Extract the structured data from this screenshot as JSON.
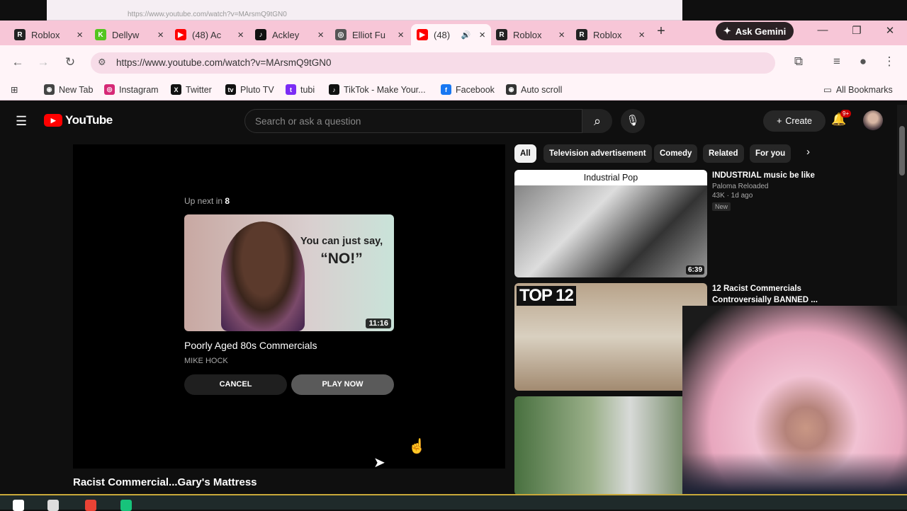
{
  "ghost_url": "https://www.youtube.com/watch?v=MArsmQ9tGN0",
  "tabs": [
    {
      "title": "Roblox",
      "fav": "R",
      "color": "#222"
    },
    {
      "title": "Dellyw",
      "fav": "K",
      "color": "#53c51f"
    },
    {
      "title": "(48) Ac",
      "fav": "▶",
      "color": "#ff0000"
    },
    {
      "title": "Ackley",
      "fav": "♪",
      "color": "#111"
    },
    {
      "title": "Elliot Fu",
      "fav": "◎",
      "color": "#555"
    },
    {
      "title": "(48)",
      "fav": "▶",
      "color": "#ff0000"
    },
    {
      "title": "Roblox",
      "fav": "R",
      "color": "#222"
    },
    {
      "title": "Roblox",
      "fav": "R",
      "color": "#222"
    }
  ],
  "new_tab": "+",
  "gemini": "Ask Gemini",
  "url": "https://www.youtube.com/watch?v=MArsmQ9tGN0",
  "bookmarks": [
    {
      "label": "New Tab",
      "icon": "◉",
      "color": "#444"
    },
    {
      "label": "Instagram",
      "icon": "◎",
      "color": "#d62976"
    },
    {
      "label": "Twitter",
      "icon": "X",
      "color": "#111"
    },
    {
      "label": "Pluto TV",
      "icon": "tv",
      "color": "#111"
    },
    {
      "label": "tubi",
      "icon": "t",
      "color": "#7b2cf5"
    },
    {
      "label": "TikTok - Make Your...",
      "icon": "♪",
      "color": "#111"
    },
    {
      "label": "Facebook",
      "icon": "f",
      "color": "#1877f2"
    },
    {
      "label": "Auto scroll",
      "icon": "◉",
      "color": "#333"
    }
  ],
  "all_bookmarks": "All Bookmarks",
  "yt": {
    "logo": "YouTube",
    "search_placeholder": "Search or ask a question",
    "create": "Create",
    "notif": "9+",
    "up_next_prefix": "Up next in ",
    "up_next_count": "8",
    "next_quote_1": "You can just say,",
    "next_quote_2": "“NO!”",
    "next_duration": "11:16",
    "next_title": "Poorly Aged 80s Commercials",
    "next_channel": "MIKE HOCK",
    "cancel": "CANCEL",
    "play_now": "PLAY NOW",
    "video_title": "Racist Commercial...Gary's Mattress",
    "chips": [
      "All",
      "Television advertisement",
      "Comedy",
      "Related",
      "For you"
    ],
    "recs": [
      {
        "banner": "Industrial Pop",
        "duration": "6:39",
        "title": "INDUSTRIAL music be like",
        "channel": "Paloma Reloaded",
        "stats": "43K · 1d ago",
        "badge": "New"
      },
      {
        "banner": "TOP 12",
        "title": "12 Racist Commercials Controversially BANNED ... are th..."
      },
      {}
    ]
  }
}
